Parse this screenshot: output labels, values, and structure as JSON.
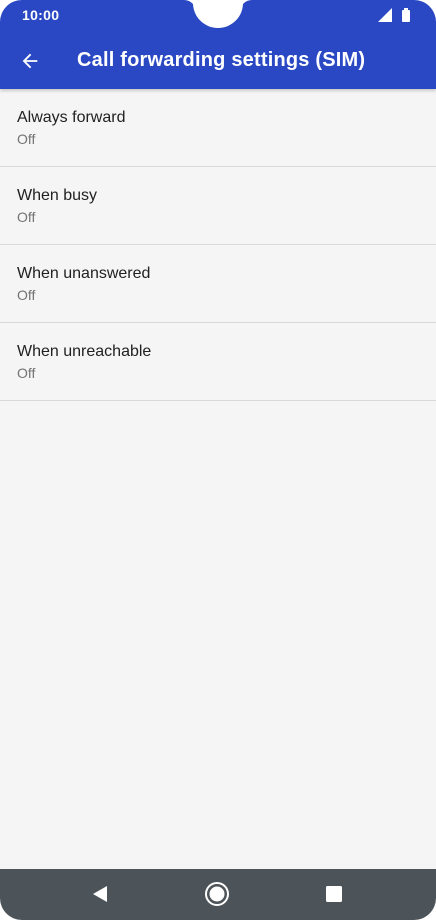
{
  "status_bar": {
    "time": "10:00",
    "icons": [
      "signal-icon",
      "battery-icon"
    ]
  },
  "app_bar": {
    "back_icon": "arrow-left-icon",
    "title": "Call forwarding settings (SIM)"
  },
  "colors": {
    "primary": "#2a48c4",
    "background": "#f5f5f5",
    "nav_bar": "#4d5459",
    "divider": "#d9d9d9"
  },
  "list": {
    "items": [
      {
        "title": "Always forward",
        "summary": "Off"
      },
      {
        "title": "When busy",
        "summary": "Off"
      },
      {
        "title": "When unanswered",
        "summary": "Off"
      },
      {
        "title": "When unreachable",
        "summary": "Off"
      }
    ]
  },
  "nav_bar": {
    "buttons": [
      "nav-back-icon",
      "nav-home-icon",
      "nav-recents-icon"
    ]
  }
}
